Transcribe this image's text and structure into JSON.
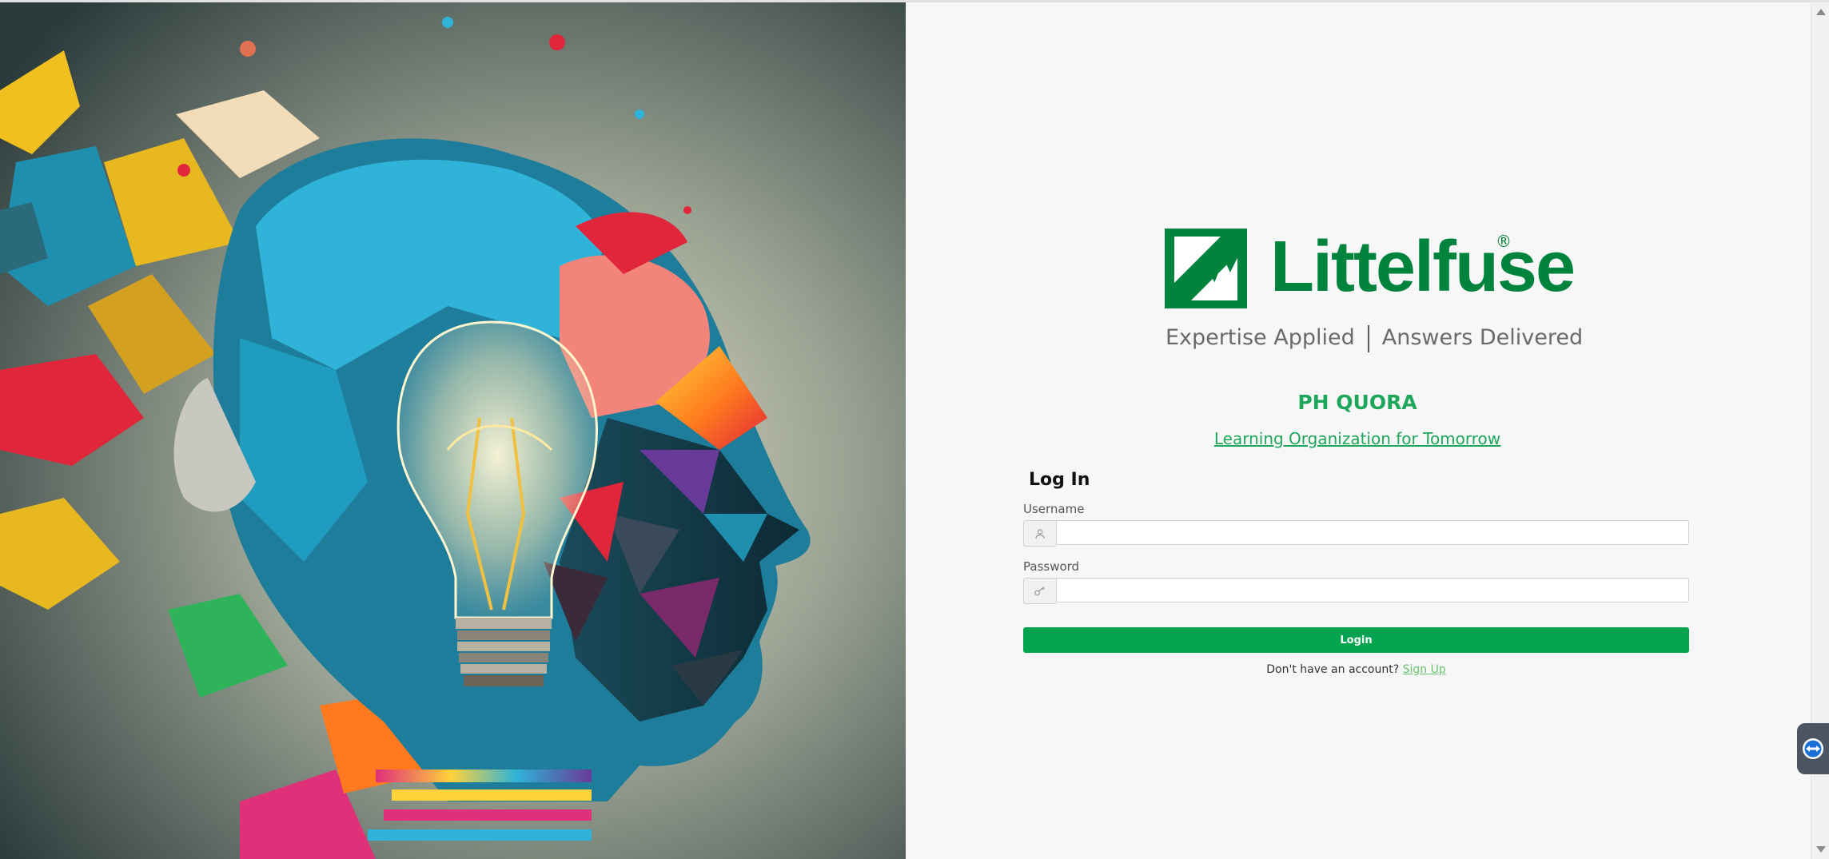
{
  "brand": {
    "name": "Littelfuse",
    "registered_mark": "®",
    "tagline_left": "Expertise Applied",
    "tagline_right": "Answers Delivered",
    "color": "#00843d"
  },
  "app": {
    "title": "PH QUORA",
    "subtitle": "Learning Organization for Tomorrow"
  },
  "login": {
    "heading": "Log In",
    "username_label": "Username",
    "username_value": "",
    "password_label": "Password",
    "password_value": "",
    "button_label": "Login",
    "signup_prompt": "Don't have an account?",
    "signup_link": "Sign Up",
    "accent": "#03a350"
  },
  "icons": {
    "username": "user-icon",
    "password": "key-icon",
    "remote": "remote-support-icon"
  }
}
